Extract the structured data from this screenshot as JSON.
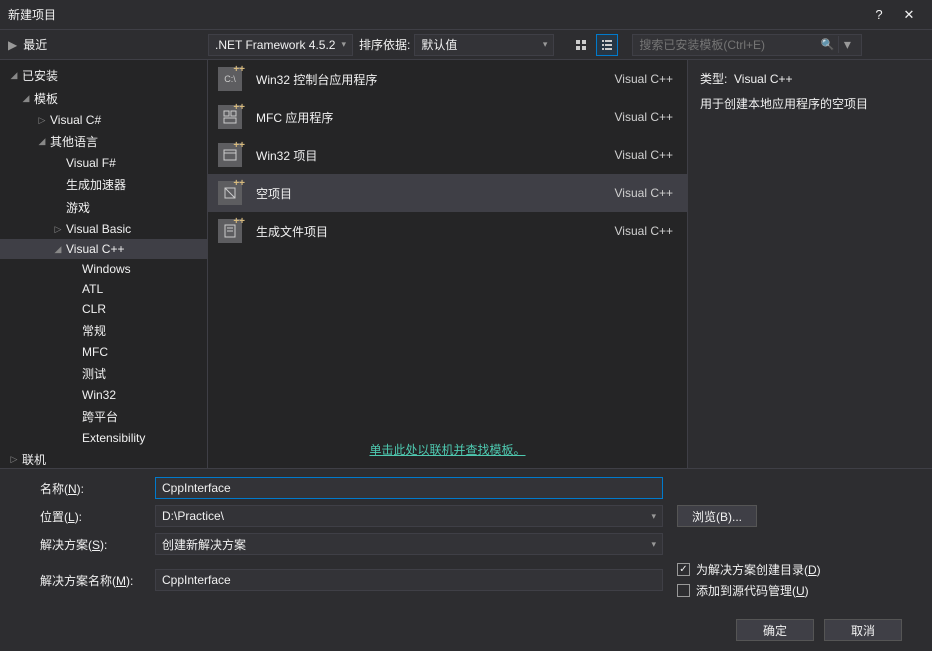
{
  "title": "新建项目",
  "toolbar": {
    "recent_label": "最近",
    "framework": ".NET Framework 4.5.2",
    "sort_label": "排序依据:",
    "sort_value": "默认值",
    "search_placeholder": "搜索已安装模板(Ctrl+E)"
  },
  "sidebar": {
    "installed_label": "已安装",
    "templates": {
      "root": "模板",
      "csharp": "Visual C#",
      "other_lang": "其他语言",
      "fsharp": "Visual F#",
      "accel": "生成加速器",
      "game": "游戏",
      "vb": "Visual Basic",
      "vcpp": "Visual C++",
      "items": [
        "Windows",
        "ATL",
        "CLR",
        "常规",
        "MFC",
        "测试",
        "Win32",
        "跨平台",
        "Extensibility"
      ]
    },
    "online_label": "联机"
  },
  "templates_list": [
    {
      "name": "Win32 控制台应用程序",
      "lang": "Visual C++"
    },
    {
      "name": "MFC 应用程序",
      "lang": "Visual C++"
    },
    {
      "name": "Win32 项目",
      "lang": "Visual C++"
    },
    {
      "name": "空项目",
      "lang": "Visual C++"
    },
    {
      "name": "生成文件项目",
      "lang": "Visual C++"
    }
  ],
  "online_link": "单击此处以联机并查找模板。",
  "detail": {
    "type_label": "类型:",
    "type_value": "Visual C++",
    "description": "用于创建本地应用程序的空项目"
  },
  "form": {
    "name_label": "名称(<u>N</u>):",
    "name_value": "CppInterface",
    "location_label": "位置(<u>L</u>):",
    "location_value": "D:\\Practice\\",
    "solution_label": "解决方案(<u>S</u>):",
    "solution_value": "创建新解决方案",
    "solution_name_label": "解决方案名称(<u>M</u>):",
    "solution_name_value": "CppInterface",
    "browse_label": "浏览(B)...",
    "cb1": "为解决方案创建目录(D)",
    "cb2": "添加到源代码管理(U)"
  },
  "buttons": {
    "ok": "确定",
    "cancel": "取消"
  }
}
